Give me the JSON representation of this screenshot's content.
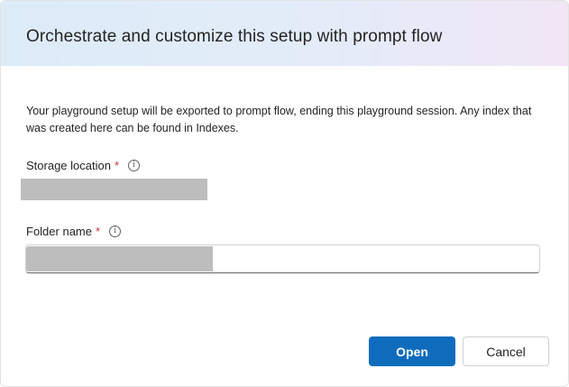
{
  "dialog": {
    "title": "Orchestrate and customize this setup with prompt flow",
    "description": "Your playground setup will be exported to prompt flow, ending this playground session. Any index that was created here can be found in Indexes."
  },
  "storage": {
    "label": "Storage location",
    "required_mark": "*",
    "info_icon": "info-icon"
  },
  "folder": {
    "label": "Folder name",
    "required_mark": "*",
    "info_icon": "info-icon"
  },
  "actions": {
    "open_label": "Open",
    "cancel_label": "Cancel"
  },
  "colors": {
    "primary": "#0f6cbd",
    "required": "#c4314b",
    "text": "#242424"
  }
}
